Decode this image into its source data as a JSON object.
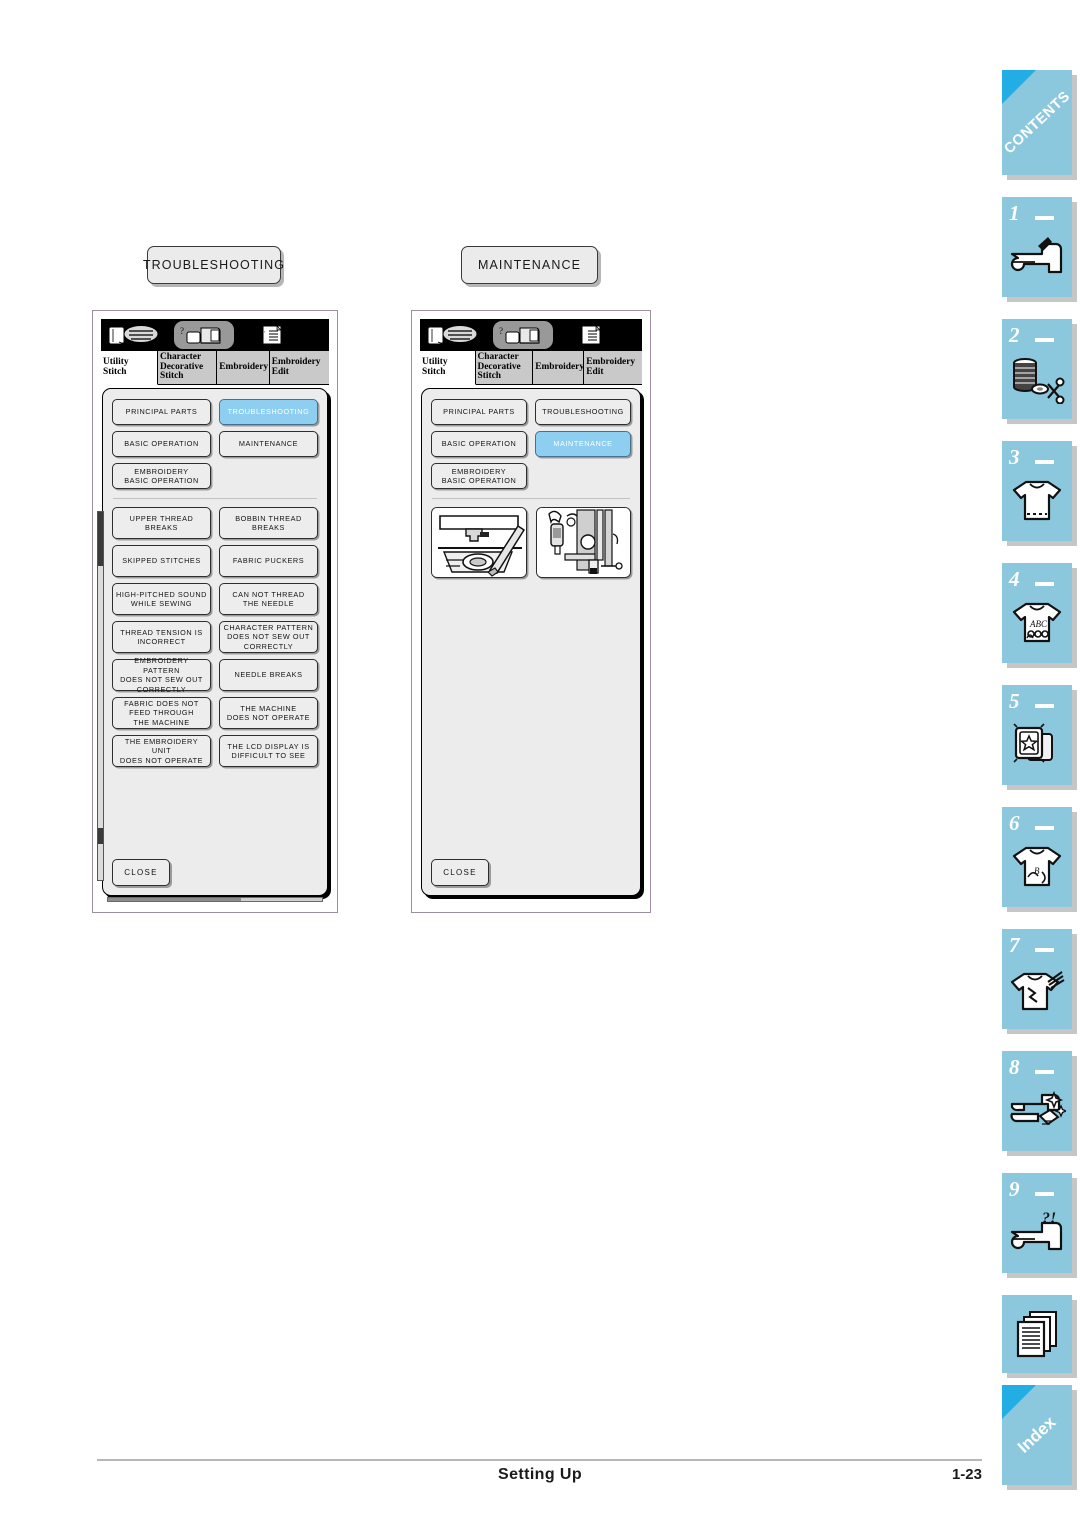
{
  "document": {
    "footer_title": "Setting Up",
    "page_number": "1-23"
  },
  "figures": [
    {
      "caption": "TROUBLESHOOTING",
      "name": "troubleshooting-screen"
    },
    {
      "caption": "MAINTENANCE",
      "name": "maintenance-screen"
    }
  ],
  "lcd": {
    "icon_tabs": [
      {
        "name": "utility-stitch-icon",
        "selected": false
      },
      {
        "name": "machine-help-icon",
        "selected": true
      },
      {
        "name": "manual-page-icon",
        "selected": false
      }
    ],
    "tabs": [
      {
        "label": "Utility\nStitch",
        "line1": "Utility",
        "line2": "Stitch",
        "line3": "",
        "active": true
      },
      {
        "label": "Character Decorative Stitch",
        "line1": "Character",
        "line2": "Decorative",
        "line3": "Stitch",
        "active": false
      },
      {
        "label": "Embroidery",
        "line1": "Embroidery",
        "line2": "",
        "line3": "",
        "active": false
      },
      {
        "label": "Embroidery Edit",
        "line1": "Embroidery",
        "line2": "Edit",
        "line3": "",
        "active": false
      }
    ],
    "close_label": "CLOSE"
  },
  "troubleshooting_screen": {
    "category_buttons": [
      {
        "label": "PRINCIPAL PARTS",
        "highlighted": false
      },
      {
        "label": "TROUBLESHOOTING",
        "highlighted": true
      },
      {
        "label": "BASIC OPERATION",
        "highlighted": false
      },
      {
        "label": "MAINTENANCE",
        "highlighted": false
      },
      {
        "label": "EMBROIDERY\nBASIC OPERATION",
        "highlighted": false
      }
    ],
    "issue_buttons": [
      "UPPER THREAD\nBREAKS",
      "BOBBIN THREAD\nBREAKS",
      "SKIPPED STITCHES",
      "FABRIC PUCKERS",
      "HIGH-PITCHED SOUND\nWHILE SEWING",
      "CAN NOT THREAD\nTHE NEEDLE",
      "THREAD TENSION IS\nINCORRECT",
      "CHARACTER PATTERN\nDOES NOT SEW OUT\nCORRECTLY",
      "EMBROIDERY PATTERN\nDOES NOT SEW OUT\nCORRECTLY",
      "NEEDLE BREAKS",
      "FABRIC DOES NOT\nFEED THROUGH\nTHE MACHINE",
      "THE MACHINE\nDOES NOT OPERATE",
      "THE EMBROIDERY UNIT\nDOES NOT OPERATE",
      "THE LCD DISPLAY IS\nDIFFICULT TO SEE"
    ]
  },
  "maintenance_screen": {
    "category_buttons": [
      {
        "label": "PRINCIPAL PARTS",
        "highlighted": false
      },
      {
        "label": "TROUBLESHOOTING",
        "highlighted": false
      },
      {
        "label": "BASIC OPERATION",
        "highlighted": false
      },
      {
        "label": "MAINTENANCE",
        "highlighted": true
      },
      {
        "label": "EMBROIDERY\nBASIC OPERATION",
        "highlighted": false
      }
    ],
    "thumbnails": [
      {
        "name": "cleaning-race-thumbnail"
      },
      {
        "name": "machine-interior-thumbnail"
      }
    ]
  },
  "index_rail": {
    "tabs": [
      {
        "number": "",
        "word": "CONTENTS",
        "icon": "contents-tab"
      },
      {
        "number": "1",
        "word": "",
        "icon": "sewing-machine-icon"
      },
      {
        "number": "2",
        "word": "",
        "icon": "spool-scissors-icon"
      },
      {
        "number": "3",
        "word": "",
        "icon": "tshirt-stitch-icon"
      },
      {
        "number": "4",
        "word": "",
        "icon": "tshirt-abc-icon"
      },
      {
        "number": "5",
        "word": "",
        "icon": "embroidery-card-icon"
      },
      {
        "number": "6",
        "word": "",
        "icon": "tshirt-monogram-icon"
      },
      {
        "number": "7",
        "word": "",
        "icon": "tshirt-torn-icon"
      },
      {
        "number": "8",
        "word": "",
        "icon": "machine-clean-icon"
      },
      {
        "number": "9",
        "word": "",
        "icon": "machine-question-icon"
      },
      {
        "number": "",
        "word": "",
        "icon": "pages-icon"
      },
      {
        "number": "",
        "word": "Index",
        "icon": "index-tab"
      }
    ]
  },
  "colors": {
    "accent_blue": "#8cc8dd",
    "corner_blue": "#22aee5",
    "highlight_button": "#8ecff1",
    "lcd_background": "#ececec"
  }
}
